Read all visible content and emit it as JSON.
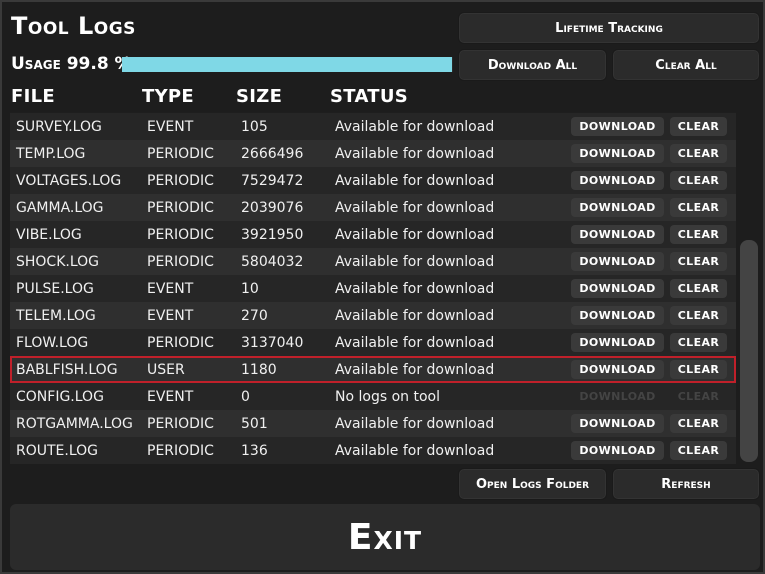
{
  "title": "Tool Logs",
  "usage": {
    "label": "Usage 99.8 %",
    "fraction": 0.998,
    "color": "#7fd8e6"
  },
  "buttons": {
    "lifetime_tracking": "Lifetime Tracking",
    "download_all": "Download All",
    "clear_all": "Clear All",
    "open_logs_folder": "Open Logs Folder",
    "refresh": "Refresh",
    "exit": "Exit"
  },
  "columns": {
    "file": "FILE",
    "type": "TYPE",
    "size": "SIZE",
    "status": "STATUS"
  },
  "row_buttons": {
    "download": "DOWNLOAD",
    "clear": "CLEAR"
  },
  "selection_color": "#c0202a",
  "logs": [
    {
      "file": "SURVEY.LOG",
      "type": "EVENT",
      "size": "105",
      "status": "Available for download",
      "enabled": true,
      "selected": false
    },
    {
      "file": "TEMP.LOG",
      "type": "PERIODIC",
      "size": "2666496",
      "status": "Available for download",
      "enabled": true,
      "selected": false
    },
    {
      "file": "VOLTAGES.LOG",
      "type": "PERIODIC",
      "size": "7529472",
      "status": "Available for download",
      "enabled": true,
      "selected": false
    },
    {
      "file": "GAMMA.LOG",
      "type": "PERIODIC",
      "size": "2039076",
      "status": "Available for download",
      "enabled": true,
      "selected": false
    },
    {
      "file": "VIBE.LOG",
      "type": "PERIODIC",
      "size": "3921950",
      "status": "Available for download",
      "enabled": true,
      "selected": false
    },
    {
      "file": "SHOCK.LOG",
      "type": "PERIODIC",
      "size": "5804032",
      "status": "Available for download",
      "enabled": true,
      "selected": false
    },
    {
      "file": "PULSE.LOG",
      "type": "EVENT",
      "size": "10",
      "status": "Available for download",
      "enabled": true,
      "selected": false
    },
    {
      "file": "TELEM.LOG",
      "type": "EVENT",
      "size": "270",
      "status": "Available for download",
      "enabled": true,
      "selected": false
    },
    {
      "file": "FLOW.LOG",
      "type": "PERIODIC",
      "size": "3137040",
      "status": "Available for download",
      "enabled": true,
      "selected": false
    },
    {
      "file": "BABLFISH.LOG",
      "type": "USER",
      "size": "1180",
      "status": "Available for download",
      "enabled": true,
      "selected": true
    },
    {
      "file": "CONFIG.LOG",
      "type": "EVENT",
      "size": "0",
      "status": "No logs on tool",
      "enabled": false,
      "selected": false
    },
    {
      "file": "ROTGAMMA.LOG",
      "type": "PERIODIC",
      "size": "501",
      "status": "Available for download",
      "enabled": true,
      "selected": false
    },
    {
      "file": "ROUTE.LOG",
      "type": "PERIODIC",
      "size": "136",
      "status": "Available for download",
      "enabled": true,
      "selected": false
    }
  ]
}
